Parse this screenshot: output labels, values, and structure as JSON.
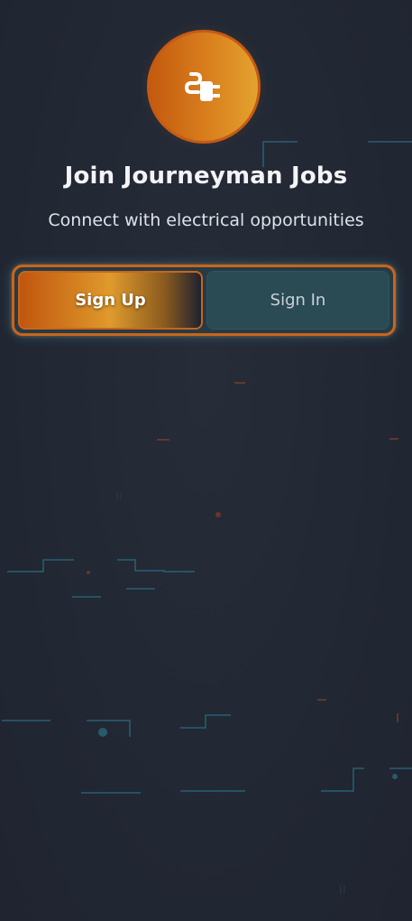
{
  "header": {
    "logo_icon": "plug-icon",
    "title": "Join Journeyman Jobs",
    "subtitle": "Connect with electrical opportunities"
  },
  "auth_tabs": {
    "items": [
      {
        "label": "Sign Up",
        "active": true
      },
      {
        "label": "Sign In",
        "active": false
      }
    ]
  },
  "colors": {
    "background": "#222834",
    "accent_orange": "#d9801e",
    "accent_teal": "#3aa7c4"
  }
}
